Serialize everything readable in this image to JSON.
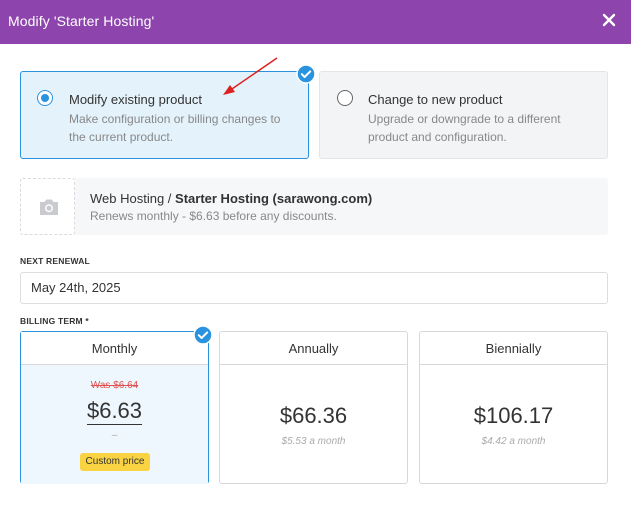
{
  "modal": {
    "title": "Modify 'Starter Hosting'",
    "close_icon": "close-icon"
  },
  "choices": {
    "modify": {
      "title": "Modify existing product",
      "description": "Make configuration or billing changes to the current product.",
      "selected": true
    },
    "change": {
      "title": "Change to new product",
      "description": "Upgrade or downgrade to a different product and configuration.",
      "selected": false
    }
  },
  "product": {
    "category": "Web Hosting",
    "separator": " / ",
    "name": "Starter Hosting (sarawong.com)",
    "renewal_info": "Renews monthly - $6.63 before any discounts.",
    "image_icon": "camera-icon"
  },
  "next_renewal": {
    "label": "NEXT RENEWAL",
    "value": "May 24th, 2025"
  },
  "billing_term": {
    "label": "BILLING TERM *",
    "terms": [
      {
        "name": "Monthly",
        "was": "Was $6.64",
        "price": "$6.63",
        "sub": "–",
        "badge": "Custom price",
        "selected": true
      },
      {
        "name": "Annually",
        "price": "$66.36",
        "sub": "$5.53 a month",
        "selected": false
      },
      {
        "name": "Biennially",
        "price": "$106.17",
        "sub": "$4.42 a month",
        "selected": false
      }
    ]
  },
  "colors": {
    "header": "#8e44ad",
    "accent": "#2a93e0",
    "selected_bg": "#e4f2fb",
    "badge": "#f9d342",
    "was_price": "#e05252",
    "arrow": "#e02020"
  }
}
